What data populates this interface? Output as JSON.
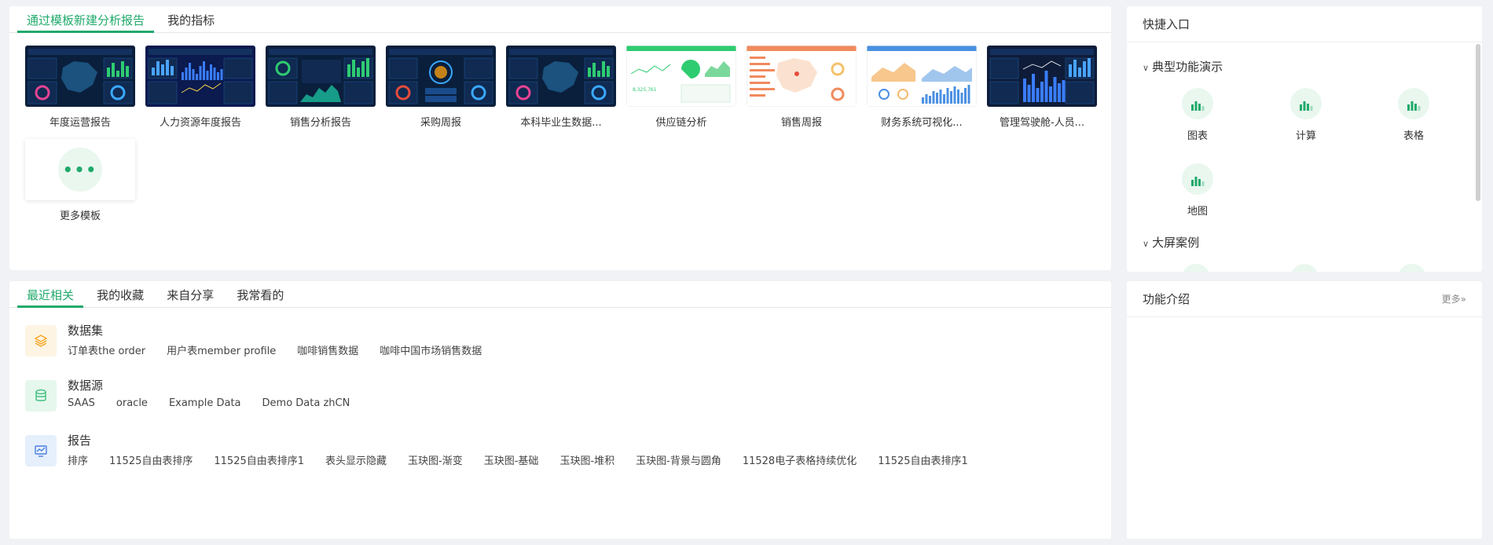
{
  "template_panel": {
    "tabs": [
      "通过模板新建分析报告",
      "我的指标"
    ],
    "templates": [
      {
        "name": "年度运营报告",
        "thumb": "dark-map"
      },
      {
        "name": "人力资源年度报告",
        "thumb": "dark-blue"
      },
      {
        "name": "销售分析报告",
        "thumb": "dark-donut"
      },
      {
        "name": "采购周报",
        "thumb": "dark-hub"
      },
      {
        "name": "本科毕业生数据...",
        "thumb": "dark-map"
      },
      {
        "name": "供应链分析",
        "thumb": "light-green"
      },
      {
        "name": "销售周报",
        "thumb": "light-orange"
      },
      {
        "name": "财务系统可视化...",
        "thumb": "light-blue"
      },
      {
        "name": "管理驾驶舱-人员...",
        "thumb": "dark-bars"
      }
    ],
    "more_label": "更多模板"
  },
  "recent_panel": {
    "tabs": [
      "最近相关",
      "我的收藏",
      "来自分享",
      "我常看的"
    ],
    "groups": [
      {
        "title": "数据集",
        "icon": "layers-icon",
        "color": "#f5a623",
        "bg": "#fef4e4",
        "items": [
          "订单表the order",
          "用户表member profile",
          "咖啡销售数据",
          "咖啡中国市场销售数据"
        ]
      },
      {
        "title": "数据源",
        "icon": "database-icon",
        "color": "#3fbf7f",
        "bg": "#e6f7ee",
        "items": [
          "SAAS",
          "oracle",
          "Example Data",
          "Demo Data zhCN"
        ]
      },
      {
        "title": "报告",
        "icon": "monitor-chart-icon",
        "color": "#4a7fe0",
        "bg": "#e6effc",
        "items": [
          "排序",
          "11525自由表排序",
          "11525自由表排序1",
          "表头显示隐藏",
          "玉玦图-渐变",
          "玉玦图-基础",
          "玉玦图-堆积",
          "玉玦图-背景与圆角",
          "11528电子表格持续优化",
          "11525自由表排序1"
        ]
      }
    ]
  },
  "quick_panel": {
    "title": "快捷入口",
    "sections": [
      {
        "title": "典型功能演示",
        "items": [
          "图表",
          "计算",
          "表格",
          "地图"
        ]
      },
      {
        "title": "大屏案例",
        "items": []
      }
    ]
  },
  "intro_panel": {
    "title": "功能介绍",
    "more_label": "更多»"
  },
  "colors": {
    "accent": "#21a96b"
  }
}
